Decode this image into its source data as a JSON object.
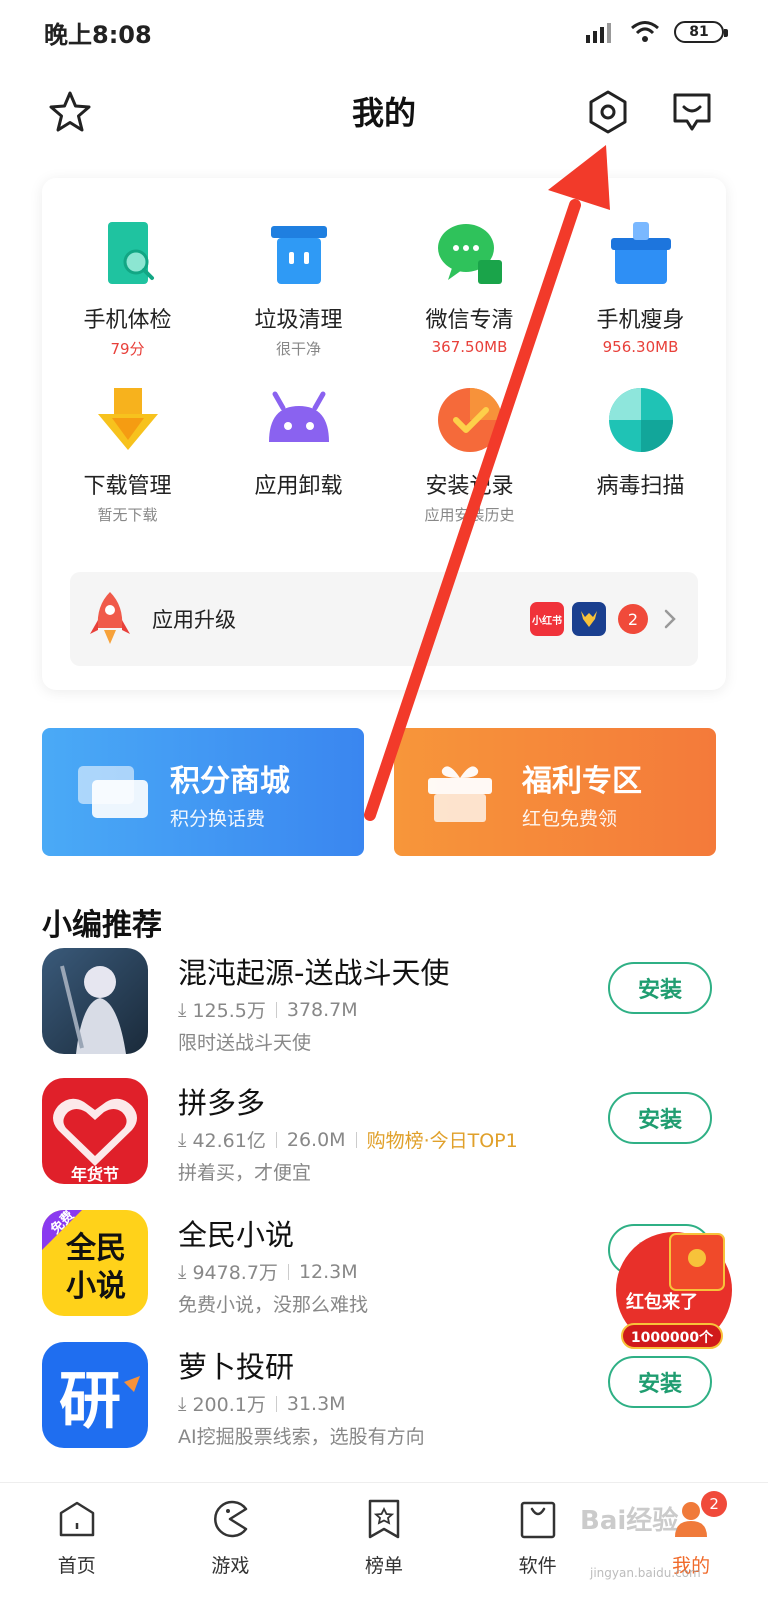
{
  "status_bar": {
    "time": "晚上8:08",
    "battery": "81"
  },
  "header": {
    "title": "我的"
  },
  "tools": [
    {
      "label": "手机体检",
      "sub": "79分",
      "sub_style": "red",
      "icon": "phone-check-icon",
      "color": "#1fc3a0"
    },
    {
      "label": "垃圾清理",
      "sub": "很干净",
      "sub_style": "gray",
      "icon": "trash-icon",
      "color": "#2f8ff0"
    },
    {
      "label": "微信专清",
      "sub": "367.50MB",
      "sub_style": "red",
      "icon": "wechat-clean-icon",
      "color": "#2fc25b"
    },
    {
      "label": "手机瘦身",
      "sub": "956.30MB",
      "sub_style": "red",
      "icon": "slim-icon",
      "color": "#2e8ff5"
    },
    {
      "label": "下载管理",
      "sub": "暂无下载",
      "sub_style": "gray",
      "icon": "download-icon",
      "color": "#f7b21d"
    },
    {
      "label": "应用卸载",
      "sub": "",
      "sub_style": "gray",
      "icon": "android-icon",
      "color": "#8a62f0"
    },
    {
      "label": "安装记录",
      "sub": "应用安装历史",
      "sub_style": "gray",
      "icon": "install-record-icon",
      "color": "#f56a3a"
    },
    {
      "label": "病毒扫描",
      "sub": "",
      "sub_style": "gray",
      "icon": "virus-scan-icon",
      "color": "#1fc3b5"
    }
  ],
  "upgrade": {
    "label": "应用升级",
    "mini_apps": [
      "小红书",
      ""
    ],
    "count": "2"
  },
  "promos": [
    {
      "title": "积分商城",
      "sub": "积分换话费",
      "color_start": "#4aaaf6",
      "color_end": "#3a86f0",
      "icon": "cards-icon"
    },
    {
      "title": "福利专区",
      "sub": "红包免费领",
      "color_start": "#f7963a",
      "color_end": "#f47a3a",
      "icon": "gift-icon"
    }
  ],
  "section": {
    "title": "小编推荐"
  },
  "apps": [
    {
      "name": "混沌起源-送战斗天使",
      "downloads": "125.5万",
      "size": "378.7M",
      "rank": "",
      "desc": "限时送战斗天使",
      "button": "安装",
      "icon": "game-avatar-icon"
    },
    {
      "name": "拼多多",
      "downloads": "42.61亿",
      "size": "26.0M",
      "rank": "购物榜·今日TOP1",
      "desc": "拼着买，才便宜",
      "button": "安装",
      "icon": "pinduoduo-icon",
      "icon_text": "年货节"
    },
    {
      "name": "全民小说",
      "downloads": "9478.7万",
      "size": "12.3M",
      "rank": "",
      "desc": "免费小说，没那么难找",
      "button": "安装",
      "icon": "novel-icon",
      "icon_text": "全民\n小说",
      "icon_tag": "免费"
    },
    {
      "name": "萝卜投研",
      "downloads": "200.1万",
      "size": "31.3M",
      "rank": "",
      "desc": "AI挖掘股票线索，选股有方向",
      "button": "安装",
      "icon": "luobo-icon",
      "icon_text": "研"
    }
  ],
  "bottom_nav": [
    {
      "label": "首页",
      "icon": "home-icon"
    },
    {
      "label": "游戏",
      "icon": "game-icon"
    },
    {
      "label": "榜单",
      "icon": "ranking-icon"
    },
    {
      "label": "软件",
      "icon": "bag-icon"
    },
    {
      "label": "我的",
      "icon": "profile-icon",
      "badge": "2",
      "active": true
    }
  ],
  "floating": {
    "text": "红包来了",
    "amount": "1000000个"
  },
  "watermark": {
    "text": "Bai经验",
    "url": "jingyan.baidu.com"
  }
}
